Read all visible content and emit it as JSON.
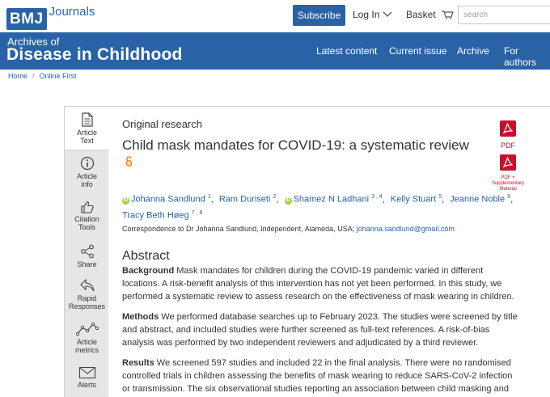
{
  "header": {
    "logo_box": "BMJ",
    "logo_text": "Journals",
    "subscribe_label": "Subscribe",
    "login_label": "Log In",
    "basket_label": "Basket",
    "search_placeholder": "search"
  },
  "banner": {
    "journal_sub": "Archives of",
    "journal_main": "Disease in Childhood",
    "nav": [
      "Latest content",
      "Current issue",
      "Archive",
      "For authors"
    ]
  },
  "breadcrumb": [
    "Home",
    "Online First"
  ],
  "sidetabs": [
    {
      "label1": "Article",
      "label2": "Text",
      "icon": "document-icon"
    },
    {
      "label1": "Article",
      "label2": "info",
      "icon": "info-icon"
    },
    {
      "label1": "Citation",
      "label2": "Tools",
      "icon": "thumbs-up-icon"
    },
    {
      "label1": "Share",
      "label2": "",
      "icon": "share-icon"
    },
    {
      "label1": "Rapid",
      "label2": "Responses",
      "icon": "reply-icon"
    },
    {
      "label1": "Article",
      "label2": "metrics",
      "icon": "metrics-icon"
    },
    {
      "label1": "Alerts",
      "label2": "",
      "icon": "envelope-icon"
    }
  ],
  "article": {
    "type": "Original research",
    "title": "Child mask mandates for COVID-19: a systematic review",
    "pdf_label": "PDF",
    "pdf_supp_label1": "PDF +",
    "pdf_supp_label2": "Supplementary",
    "pdf_supp_label3": "Material",
    "authors_line1": [
      {
        "name": "Johanna Sandlund",
        "sup": "1",
        "orcid": true
      },
      {
        "name": "Ram Duriseti",
        "sup": "2",
        "orcid": false
      },
      {
        "name": "Shamez N Ladhani",
        "sup": "3 , 4",
        "orcid": true
      },
      {
        "name": "Kelly Stuart",
        "sup": "5",
        "orcid": false
      },
      {
        "name": "Jeanne Noble",
        "sup": "6",
        "orcid": false
      }
    ],
    "authors_line2": [
      {
        "name": "Tracy Beth Høeg",
        "sup": "7 , 8",
        "orcid": false
      }
    ],
    "correspondence_text": "Correspondence to Dr Johanna Sandlund, Independent, Alameda, USA;",
    "correspondence_email": "johanna.sandlund@gmail.com",
    "abstract_heading": "Abstract",
    "background_label": "Background",
    "background_text": " Mask mandates for children during the COVID-19 pandemic varied in different locations. A risk-benefit analysis of this intervention has not yet been performed. In this study, we performed a systematic review to assess research on the effectiveness of mask wearing in children.",
    "methods_label": "Methods",
    "methods_text": " We performed database searches up to February 2023. The studies were screened by title and abstract, and included studies were further screened as full-text references. A risk-of-bias analysis was performed by two independent reviewers and adjudicated by a third reviewer.",
    "results_label": "Results",
    "results_text": " We screened 597 studies and included 22 in the final analysis. There were no randomised controlled trials in children assessing the benefits of mask wearing to reduce SARS-CoV-2 infection or transmission. The six observational studies reporting an association between child masking and lower"
  }
}
